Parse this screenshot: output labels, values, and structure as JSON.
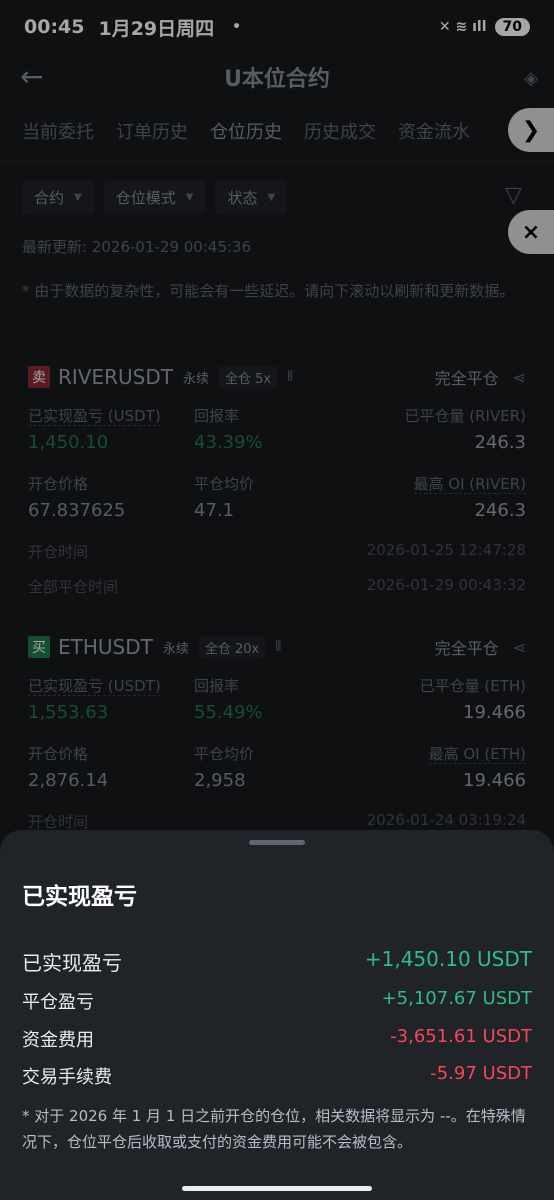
{
  "status_bar": {
    "time": "00:45",
    "date": "1月29日周四",
    "dot": "•",
    "icons_text": "✕  ≋  ıll",
    "battery": "70"
  },
  "header": {
    "back_icon": "←",
    "title": "U本位合约"
  },
  "tabs": [
    "当前委托",
    "订单历史",
    "仓位历史",
    "历史成交",
    "资金流水"
  ],
  "active_tab": 2,
  "float_buttons": [
    "❯",
    "⨯"
  ],
  "filters": {
    "contract": "合约",
    "mode": "仓位模式",
    "status": "状态"
  },
  "last_updated": "最新更新: 2026-01-29 00:45:36",
  "notice": "* 由于数据的复杂性，可能会有一些延迟。请向下滚动以刷新和更新数据。",
  "positions": [
    {
      "side": "卖",
      "symbol": "RIVERUSDT",
      "type": "永续",
      "margin": "全仓 5x",
      "close_label": "完全平仓",
      "realized_pnl_label": "已实现盈亏 (USDT)",
      "realized_pnl": "1,450.10",
      "roi_label": "回报率",
      "roi": "43.39%",
      "closed_qty_label": "已平仓量 (RIVER)",
      "closed_qty": "246.3",
      "entry_label": "开仓价格",
      "entry": "67.837625",
      "avg_close_label": "平仓均价",
      "avg_close": "47.1",
      "max_oi_label": "最高 OI (RIVER)",
      "max_oi": "246.3",
      "open_time_label": "开仓时间",
      "open_time": "2026-01-25 12:47:28",
      "close_time_label": "全部平仓时间",
      "close_time": "2026-01-29 00:43:32"
    },
    {
      "side": "买",
      "symbol": "ETHUSDT",
      "type": "永续",
      "margin": "全仓 20x",
      "close_label": "完全平仓",
      "realized_pnl_label": "已实现盈亏 (USDT)",
      "realized_pnl": "1,553.63",
      "roi_label": "回报率",
      "roi": "55.49%",
      "closed_qty_label": "已平仓量 (ETH)",
      "closed_qty": "19.466",
      "entry_label": "开仓价格",
      "entry": "2,876.14",
      "avg_close_label": "平仓均价",
      "avg_close": "2,958",
      "max_oi_label": "最高 OI (ETH)",
      "max_oi": "19.466",
      "open_time_label": "开仓时间",
      "open_time": "2026-01-24 03:19:24"
    }
  ],
  "sheet": {
    "title": "已实现盈亏",
    "rows": [
      {
        "label": "已实现盈亏",
        "value": "+1,450.10 USDT"
      },
      {
        "label": "平仓盈亏",
        "value": "+5,107.67 USDT"
      },
      {
        "label": "资金费用",
        "value": "-3,651.61 USDT"
      },
      {
        "label": "交易手续费",
        "value": "-5.97 USDT"
      }
    ],
    "note": "* 对于 2026 年 1 月 1 日之前开仓的仓位，相关数据将显示为 --。在特殊情况下，仓位平仓后收取或支付的资金费用可能不会被包含。"
  },
  "colors": {
    "positive": "#2ebd85",
    "negative": "#f6465d",
    "accent": "#a48a2d"
  }
}
